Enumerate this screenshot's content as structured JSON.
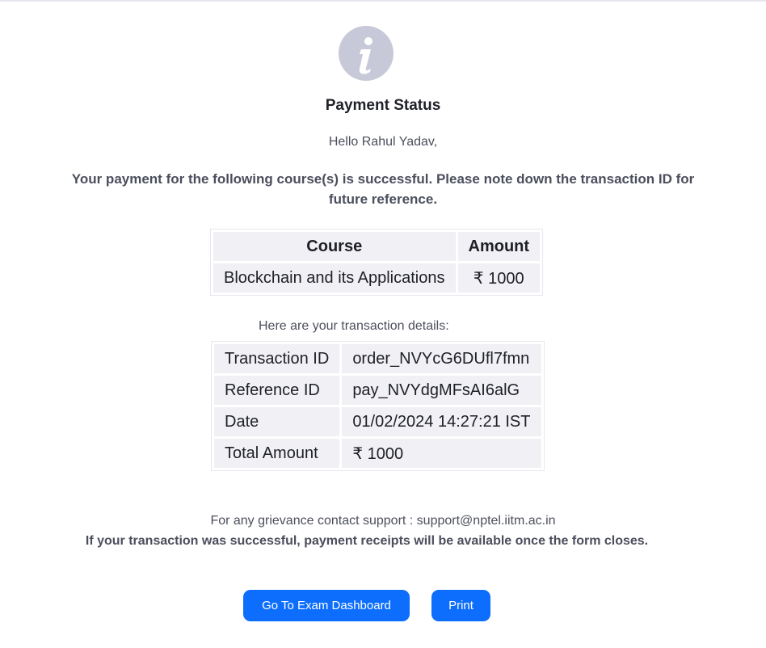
{
  "status": {
    "icon": "info-icon",
    "title": "Payment Status",
    "greeting": "Hello Rahul Yadav,",
    "message": "Your payment for the following course(s) is successful. Please note down the transaction ID for future reference."
  },
  "course_table": {
    "headers": [
      "Course",
      "Amount"
    ],
    "rows": [
      [
        "Blockchain and its Applications",
        "₹ 1000"
      ]
    ]
  },
  "transaction": {
    "intro": "Here are your transaction details:",
    "rows": [
      [
        "Transaction ID",
        "order_NVYcG6DUfl7fmn"
      ],
      [
        "Reference ID",
        "pay_NVYdgMFsAI6alG"
      ],
      [
        "Date",
        "01/02/2024 14:27:21 IST"
      ],
      [
        "Total Amount",
        "₹ 1000"
      ]
    ]
  },
  "footer": {
    "support": "For any grievance contact support : support@nptel.iitm.ac.in",
    "receipt_note": "If your transaction was successful, payment receipts will be available once the form closes."
  },
  "actions": {
    "dashboard_label": "Go To Exam Dashboard",
    "print_label": "Print"
  },
  "colors": {
    "accent": "#0d6efd",
    "icon_bg": "#c7c9d9",
    "table_cell_bg": "#f0f0f5"
  }
}
